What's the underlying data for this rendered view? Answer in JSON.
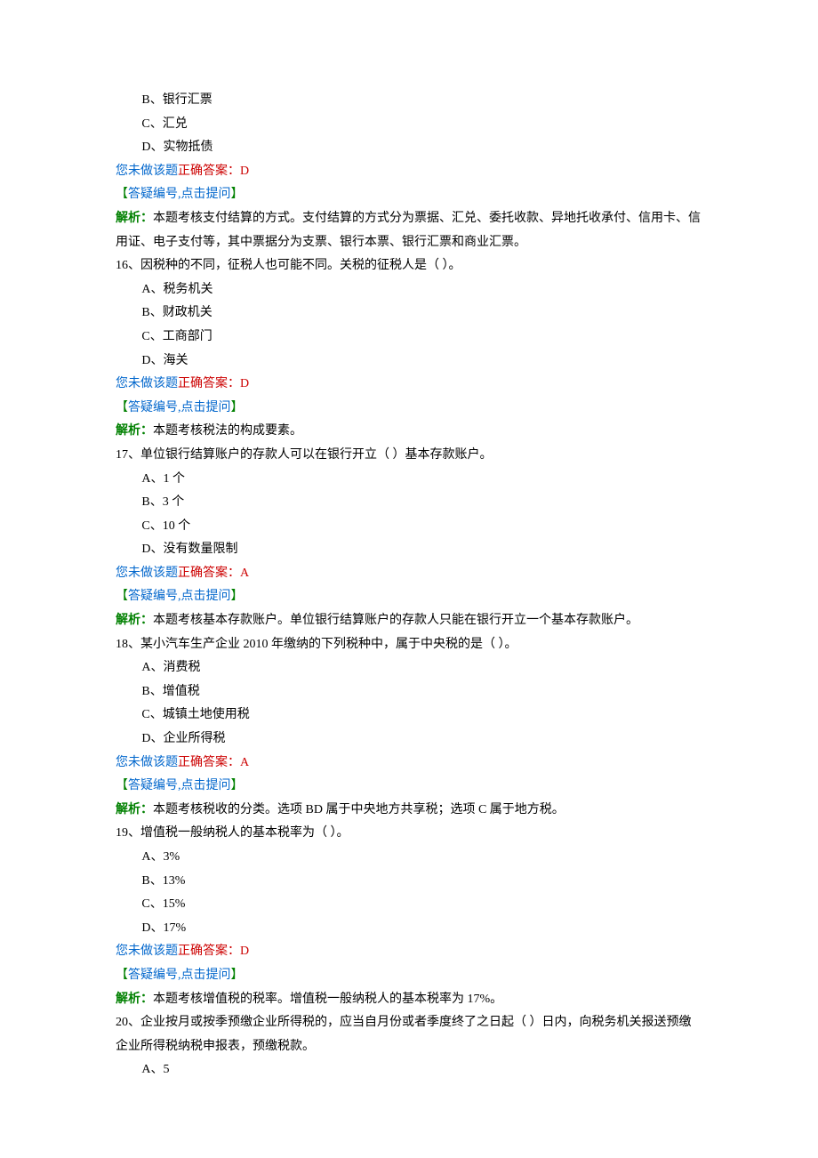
{
  "labels": {
    "not_done": "您未做该题",
    "correct_answer_prefix": "正确答案：",
    "question_link": "答疑编号,点击提问",
    "analysis_prefix": "解析：",
    "bracket_open": "【",
    "bracket_close": "】"
  },
  "q15_partial": {
    "options": [
      "B、银行汇票",
      "C、汇兑",
      "D、实物抵债"
    ],
    "answer": "D",
    "analysis": "本题考核支付结算的方式。支付结算的方式分为票据、汇兑、委托收款、异地托收承付、信用卡、信用证、电子支付等，其中票据分为支票、银行本票、银行汇票和商业汇票。"
  },
  "q16": {
    "stem": "16、因税种的不同，征税人也可能不同。关税的征税人是（ ）。",
    "options": [
      "A、税务机关",
      "B、财政机关",
      "C、工商部门",
      "D、海关"
    ],
    "answer": "D",
    "analysis": "本题考核税法的构成要素。"
  },
  "q17": {
    "stem": "17、单位银行结算账户的存款人可以在银行开立（ ）基本存款账户。",
    "options": [
      "A、1 个",
      "B、3 个",
      "C、10 个",
      "D、没有数量限制"
    ],
    "answer": "A",
    "analysis": "本题考核基本存款账户。单位银行结算账户的存款人只能在银行开立一个基本存款账户。"
  },
  "q18": {
    "stem": "18、某小汽车生产企业 2010 年缴纳的下列税种中，属于中央税的是（ ）。",
    "options": [
      "A、消费税",
      "B、增值税",
      "C、城镇土地使用税",
      "D、企业所得税"
    ],
    "answer": "A",
    "analysis": "本题考核税收的分类。选项 BD 属于中央地方共享税；选项 C 属于地方税。"
  },
  "q19": {
    "stem": "19、增值税一般纳税人的基本税率为（ ）。",
    "options": [
      "A、3%",
      "B、13%",
      "C、15%",
      "D、17%"
    ],
    "answer": "D",
    "analysis": "本题考核增值税的税率。增值税一般纳税人的基本税率为 17%。"
  },
  "q20_partial": {
    "stem": "20、企业按月或按季预缴企业所得税的，应当自月份或者季度终了之日起（ ）日内，向税务机关报送预缴企业所得税纳税申报表，预缴税款。",
    "options": [
      "A、5"
    ]
  }
}
